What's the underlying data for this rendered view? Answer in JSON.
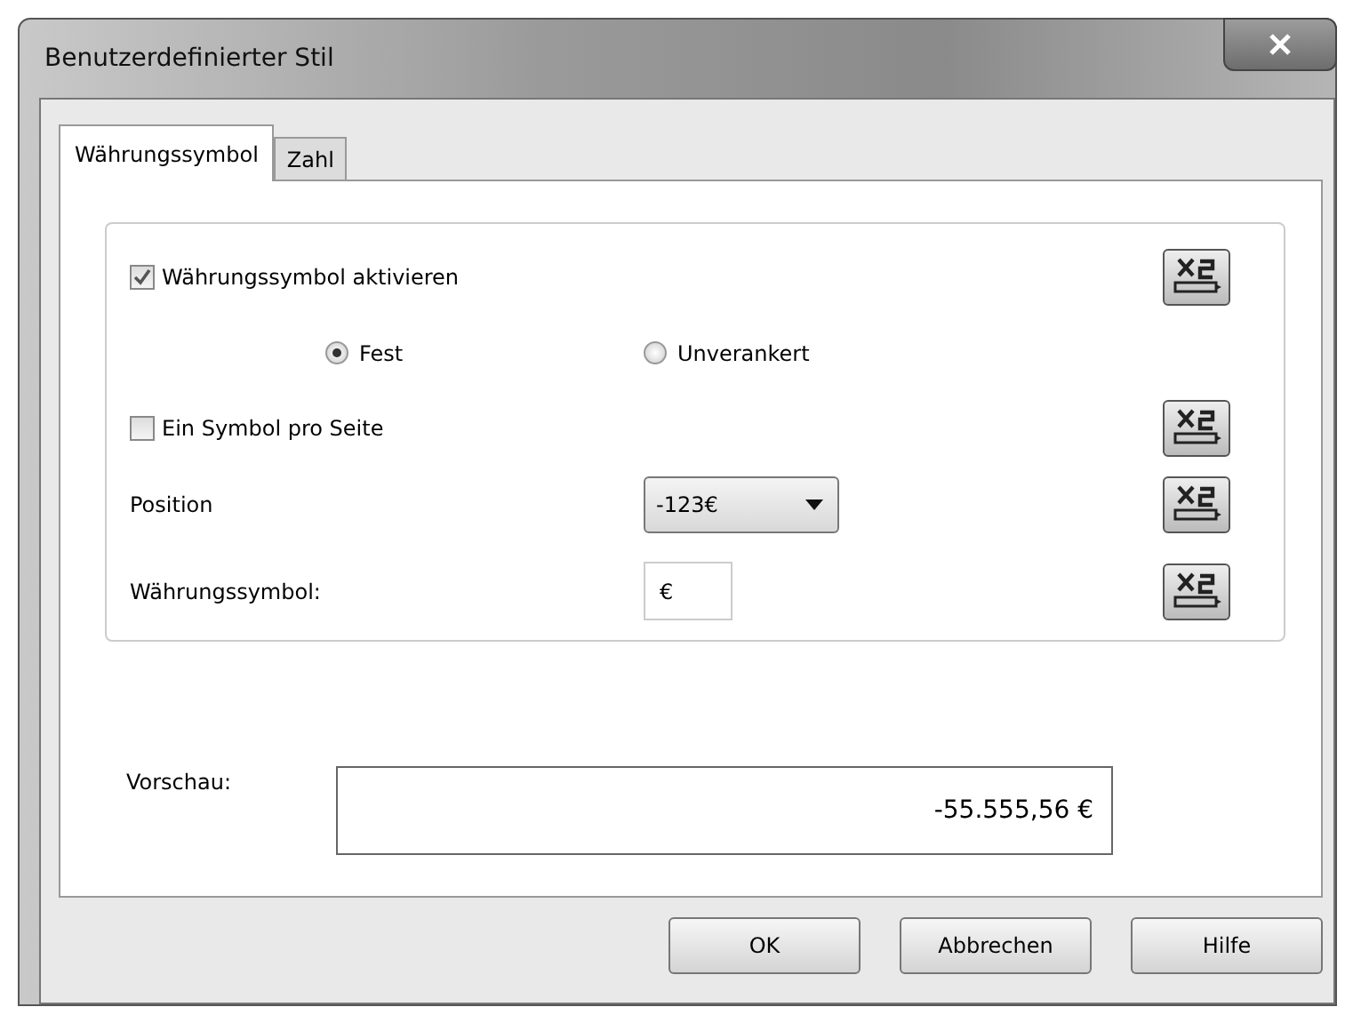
{
  "window": {
    "title": "Benutzerdefinierter Stil"
  },
  "tabs": [
    {
      "label": "Währungssymbol",
      "selected": true
    },
    {
      "label": "Zahl",
      "selected": false
    }
  ],
  "rows": [
    {
      "kind": "checkbox",
      "label": "Währungssymbol aktivieren",
      "checked": true
    },
    {
      "kind": "radios",
      "options": [
        {
          "label": "Fest",
          "selected": true
        },
        {
          "label": "Unverankert",
          "selected": false
        }
      ]
    },
    {
      "kind": "checkbox",
      "label": "Ein Symbol pro Seite",
      "checked": false
    },
    {
      "kind": "dropdown",
      "label": "Position",
      "value": "-123€"
    },
    {
      "kind": "text",
      "label": "Währungssymbol:",
      "value": "€"
    }
  ],
  "preview": {
    "label": "Vorschau:",
    "value": "-55.555,56 €"
  },
  "buttons": [
    "OK",
    "Abbrechen",
    "Hilfe"
  ]
}
